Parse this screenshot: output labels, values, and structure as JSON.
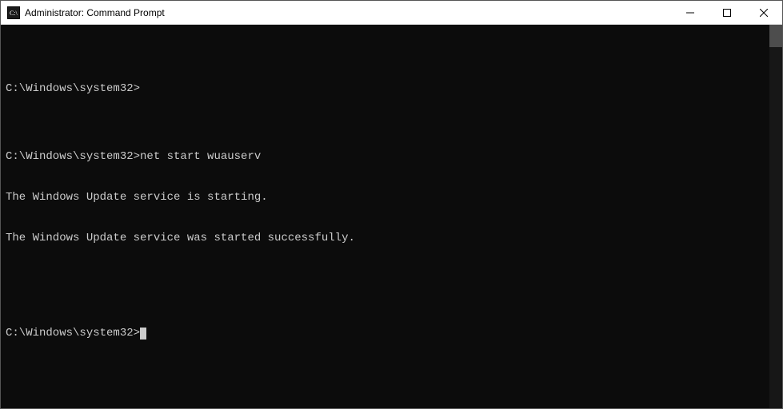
{
  "window": {
    "title": "Administrator: Command Prompt"
  },
  "terminal": {
    "lines": [
      "",
      "C:\\Windows\\system32>",
      "",
      "C:\\Windows\\system32>net start wuauserv",
      "The Windows Update service is starting.",
      "The Windows Update service was started successfully.",
      "",
      "",
      "C:\\Windows\\system32>"
    ]
  }
}
